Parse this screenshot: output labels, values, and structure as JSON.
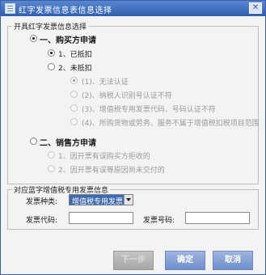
{
  "window": {
    "title": "红字发票信息表信息选择",
    "close_glyph": "✕"
  },
  "group_main": {
    "legend": "开具红字发票信息选择",
    "buyer": {
      "label": "一、购买方申请",
      "deducted": "1、已抵扣",
      "not_deducted": "2、未抵扣",
      "reasons": [
        "(1)、无法认证",
        "(2)、纳税人识别号认证不符",
        "(3)、增值税专用发票代码、号码认证不符",
        "(4)、所购货物或劳务、服务不属于增值税扣税项目范围"
      ]
    },
    "seller": {
      "label": "二、销售方申请",
      "options": [
        "1、因开票有误购买方拒收的",
        "2、因开票有误等原因尚未交付的"
      ]
    }
  },
  "group_invoice": {
    "legend": "对应蓝字增值税专用发票信息",
    "type_label": "发票种类:",
    "type_value": "增值税专用发票",
    "code_label": "发票代码:",
    "code_value": "",
    "number_label": "发票号码:",
    "number_value": ""
  },
  "buttons": {
    "next": "下一步",
    "ok": "确定",
    "cancel": "取消"
  }
}
